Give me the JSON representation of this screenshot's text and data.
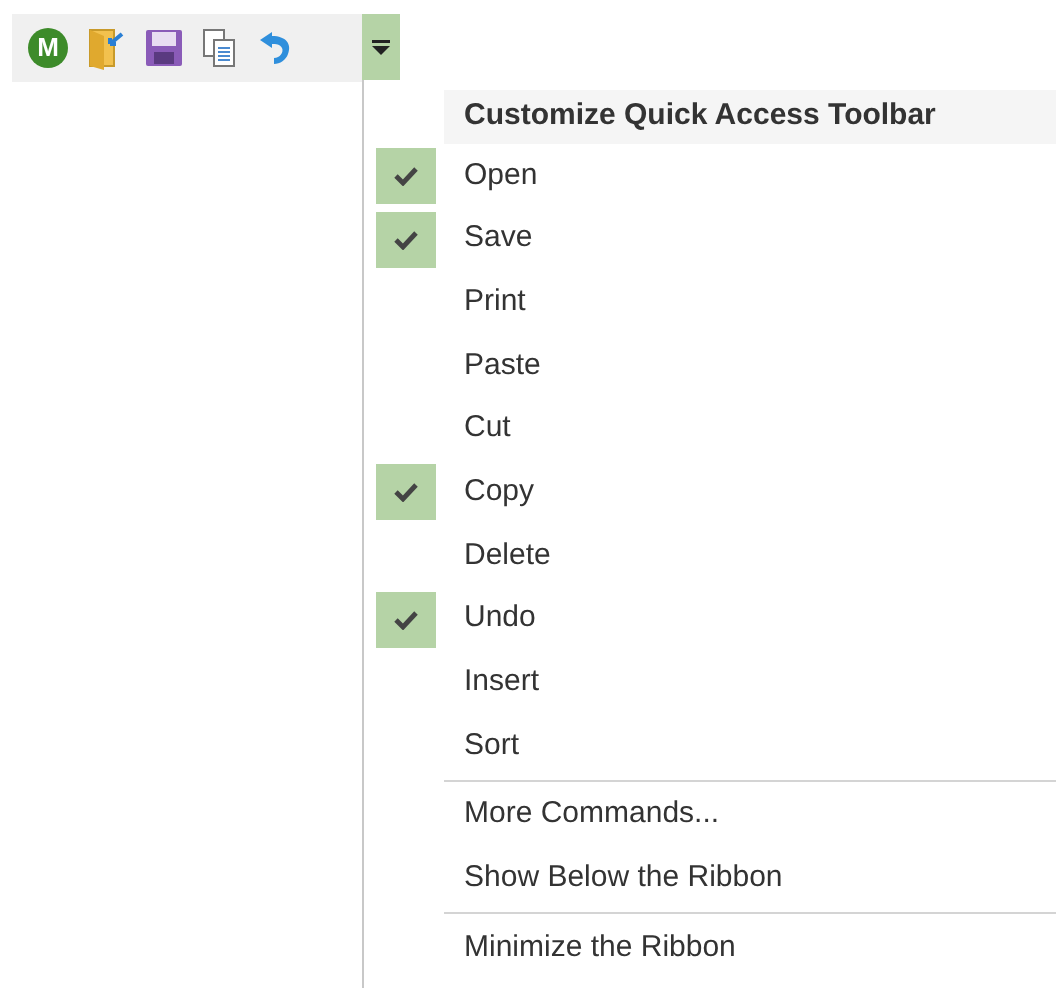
{
  "toolbar": {
    "logo_letter": "M",
    "buttons": [
      {
        "kind": "open"
      },
      {
        "kind": "save"
      },
      {
        "kind": "copy"
      },
      {
        "kind": "undo"
      }
    ]
  },
  "menu": {
    "title": "Customize Quick Access Toolbar",
    "items": [
      {
        "label": "Open",
        "checked": true
      },
      {
        "label": "Save",
        "checked": true
      },
      {
        "label": "Print",
        "checked": false
      },
      {
        "label": "Paste",
        "checked": false
      },
      {
        "label": "Cut",
        "checked": false
      },
      {
        "label": "Copy",
        "checked": true
      },
      {
        "label": "Delete",
        "checked": false
      },
      {
        "label": "Undo",
        "checked": true
      },
      {
        "label": "Insert",
        "checked": false
      },
      {
        "label": "Sort",
        "checked": false
      }
    ],
    "commands": [
      "More Commands...",
      "Show Below the Ribbon"
    ],
    "last": "Minimize the Ribbon"
  }
}
